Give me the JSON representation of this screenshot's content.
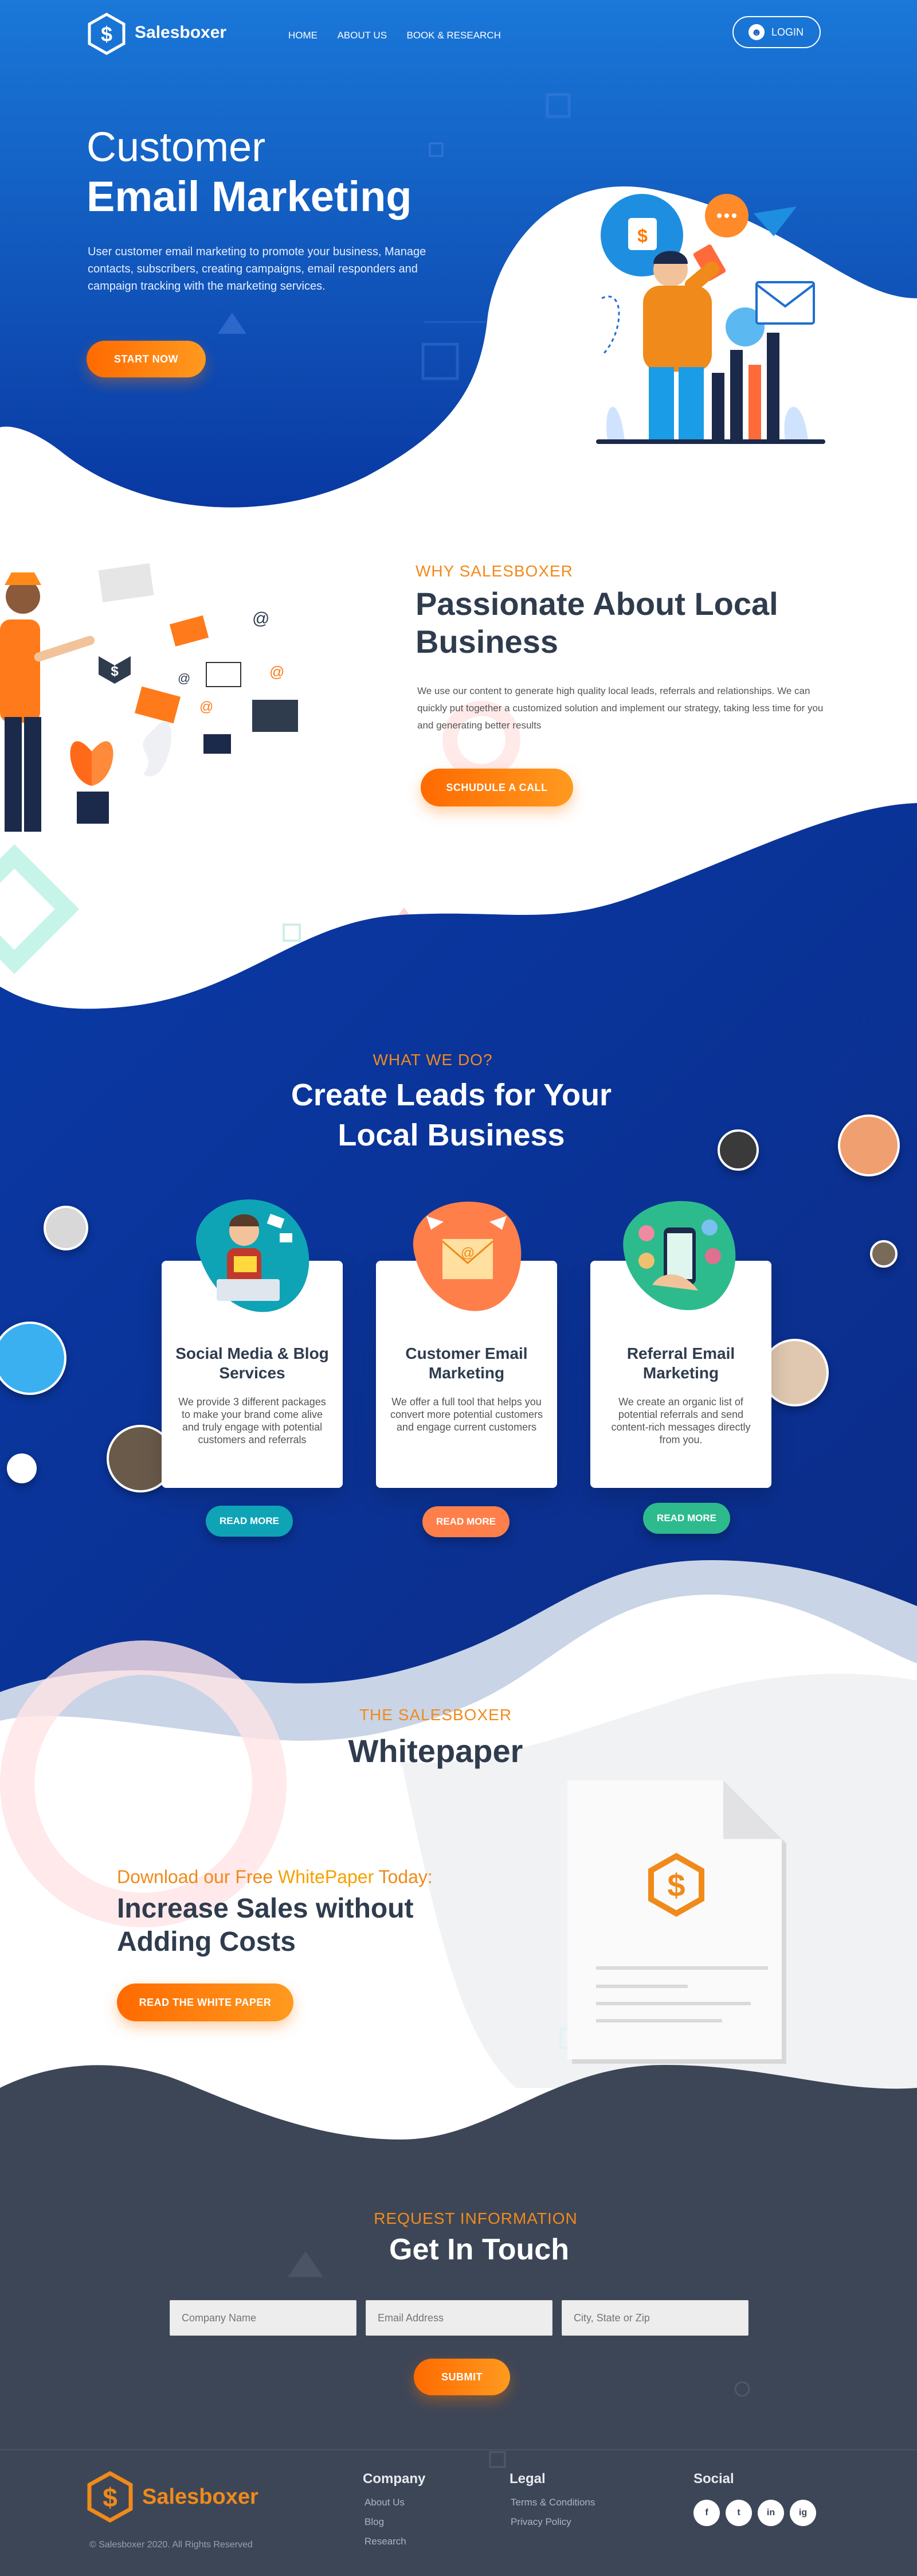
{
  "nav": {
    "brand": "Salesboxer",
    "items": [
      "HOME",
      "ABOUT US",
      "BOOK & RESEARCH"
    ],
    "login": "LOGIN"
  },
  "hero": {
    "title_line1": "Customer",
    "title_line2": "Email Marketing",
    "description": "User customer email marketing to promote your business, Manage contacts, subscribers, creating campaigns, email responders and campaign tracking with the marketing services.",
    "cta": "START NOW"
  },
  "why": {
    "eyebrow": "WHY SALESBOXER",
    "title": "Passionate About Local Business",
    "text": "We use our content to generate high quality local leads, referrals and relationships. We can quickly put together a customized solution and implement our strategy, taking less time for you and generating better results",
    "cta": "SCHUDULE A CALL"
  },
  "services": {
    "eyebrow": "WHAT WE DO?",
    "title_line1": "Create Leads for Your",
    "title_line2": "Local Business",
    "cards": [
      {
        "title": "Social Media & Blog Services",
        "text": "We provide 3 different packages to make your brand come alive and truly engage with potential customers and referrals",
        "cta": "READ MORE",
        "color": "#0fa3b6"
      },
      {
        "title": "Customer Email Marketing",
        "text": "We offer a full tool that helps you convert more potential customers and engage current customers",
        "cta": "READ MORE",
        "color": "#ff7f4a"
      },
      {
        "title": "Referral Email Marketing",
        "text": "We create an organic list of potential referrals and send content-rich messages directly from you.",
        "cta": "READ MORE",
        "color": "#2dbb8d"
      }
    ]
  },
  "whitepaper": {
    "eyebrow": "THE SALESBOXER",
    "title": "Whitepaper",
    "sub_prefix": "Download our Free ",
    "sub_highlight": "WhitePaper",
    "sub_suffix": " Today:",
    "headline_line1": "Increase Sales without",
    "headline_line2": "Adding Costs",
    "cta": "READ THE WHITE PAPER"
  },
  "contact": {
    "eyebrow": "REQUEST INFORMATION",
    "title": "Get In Touch",
    "company_placeholder": "Company Name",
    "email_placeholder": "Email Address",
    "city_placeholder": "City, State or Zip",
    "submit": "SUBMIT"
  },
  "footer": {
    "brand": "Salesboxer",
    "copyright": "© Salesboxer 2020. All Rights Reserved",
    "company_heading": "Company",
    "company_links": [
      "About Us",
      "Blog",
      "Research"
    ],
    "legal_heading": "Legal",
    "legal_links": [
      "Terms & Conditions",
      "Privacy Policy"
    ],
    "social_heading": "Social",
    "social_icons": [
      "f",
      "t",
      "in",
      "ig"
    ]
  },
  "colors": {
    "primary_blue": "#0a3a9e",
    "accent_orange": "#ff7a00",
    "dark_navy": "#3d4657"
  }
}
